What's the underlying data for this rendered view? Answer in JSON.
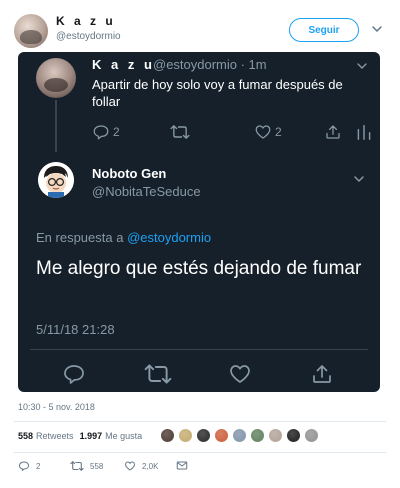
{
  "outer_tweet": {
    "author_name": "K a z u",
    "author_handle": "@estoydormio",
    "follow_label": "Seguir",
    "timestamp": "10:30 - 5 nov. 2018",
    "retweets_count": "558",
    "retweets_label": "Retweets",
    "likes_count": "1.997",
    "likes_label": "Me gusta",
    "actions": {
      "reply_count": "2",
      "retweet_count": "558",
      "like_count": "2,0K"
    }
  },
  "embedded": {
    "quoted": {
      "author_name": "K a z u",
      "meta": "@estoydormio · 1m",
      "text": "Apartir de hoy solo voy a fumar después de follar",
      "reply_count": "2",
      "like_count": "2"
    },
    "reply": {
      "author_name": "Noboto Gen",
      "author_handle": "@NobitaTeSeduce",
      "reply_prefix": "En respuesta a",
      "reply_mention": "@estoydormio",
      "text": "Me alegro que estés dejando de fumar",
      "timestamp": "5/11/18 21:28"
    }
  },
  "icons": [
    "chevron-down-icon",
    "reply-icon",
    "retweet-icon",
    "heart-icon",
    "share-icon",
    "stats-icon",
    "mail-icon"
  ],
  "colors": {
    "accent": "#1da1f2",
    "dark_background": "#15202b",
    "muted": "#8899a6",
    "liker_avatars": [
      "#5b4a44",
      "#c9b27a",
      "#3a3a3a",
      "#d06b4a",
      "#8a9cb0",
      "#6d8a6a",
      "#b7a9a0",
      "#2f2f2f",
      "#9a9a9a"
    ]
  }
}
